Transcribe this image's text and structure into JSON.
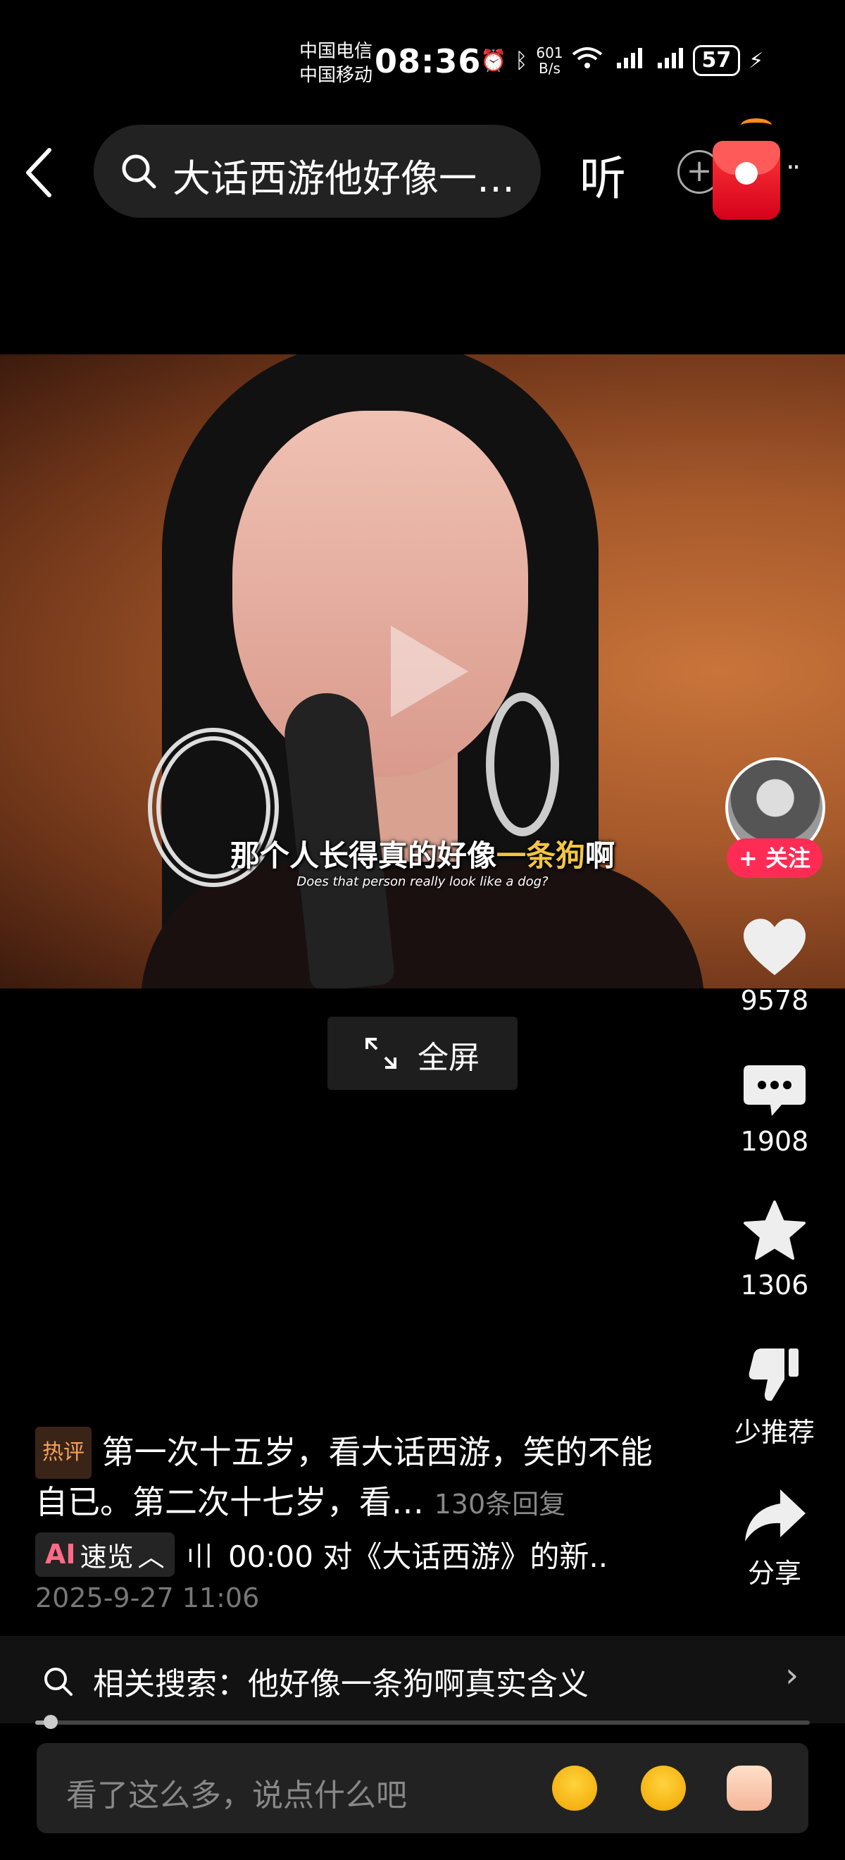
{
  "status_bar": {
    "carrier1": "中国电信",
    "carrier2": "中国移动",
    "time": "08:36",
    "net_speed_top": "601",
    "net_speed_bottom": "B/s",
    "battery": "57"
  },
  "header": {
    "search_text": "大话西游他好像一…",
    "listen_label": "听"
  },
  "video": {
    "subtitle_pre": "那个人长得真的好像",
    "subtitle_highlight": "一条狗",
    "subtitle_post": "啊",
    "subtitle_en": "Does that person really look like a dog?",
    "fullscreen_label": "全屏"
  },
  "actions": {
    "follow_label": "+ 关注",
    "likes": "9578",
    "comments": "1908",
    "favorites": "1306",
    "not_recommend": "少推荐",
    "share": "分享"
  },
  "comment": {
    "tag": "热评",
    "text": "第一次十五岁，看大话西游，笑的不能自已。第二次十七岁，看…",
    "replies": "130条回复"
  },
  "ai_summary": {
    "ai_label": "AI",
    "label": "速览",
    "text": "00:00 对《大话西游》的新.."
  },
  "date": "2025-9-27 11:06",
  "related": {
    "text": "相关搜索：他好像一条狗啊真实含义"
  },
  "progress": 0.02,
  "input": {
    "placeholder": "看了这么多，说点什么吧"
  }
}
